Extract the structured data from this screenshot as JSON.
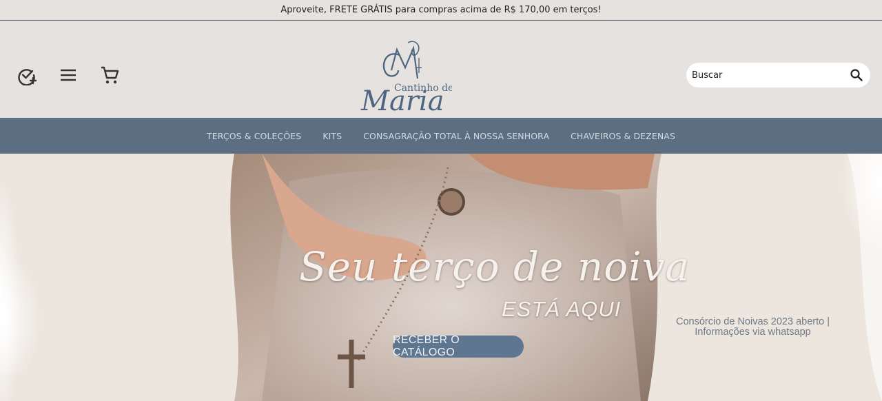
{
  "announcement": {
    "text": "Aproveite, FRETE GRÁTIS para compras acima de R$ 170,00 em terços!"
  },
  "header": {
    "icons": [
      "check-circle-plus-icon",
      "menu-icon",
      "cart-icon"
    ],
    "logo": {
      "line1": "Cantinho de",
      "line2": "Maria"
    },
    "search": {
      "placeholder": "Buscar",
      "value": ""
    }
  },
  "nav": {
    "items": [
      {
        "label": "TERÇOS & COLEÇÕES"
      },
      {
        "label": "KITS"
      },
      {
        "label": "CONSAGRAÇÃO TOTAL À NOSSA SENHORA"
      },
      {
        "label": "CHAVEIROS & DEZENAS"
      }
    ]
  },
  "hero": {
    "script_title": "Seu terço de noiva",
    "subtitle": "ESTÁ AQUI",
    "cta_label": "RECEBER O CATÁLOGO",
    "promo_line1": "Consórcio de Noivas 2023 aberto |",
    "promo_line2": "Informações via whatsapp"
  },
  "colors": {
    "background": "#e6e2df",
    "nav_bg": "#5b6e82",
    "nav_text": "#d4dbe3",
    "logo": "#4f6680",
    "cta_bg": "#5e7690"
  }
}
